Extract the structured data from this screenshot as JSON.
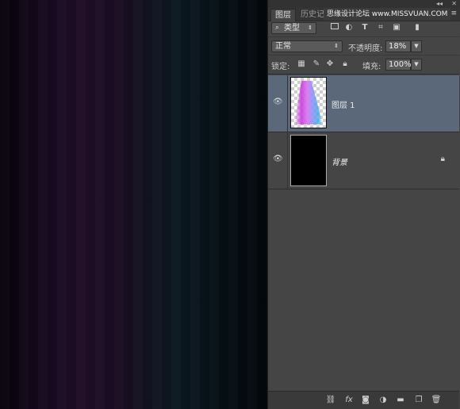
{
  "panel": {
    "tabs": [
      {
        "label": "图层"
      },
      {
        "label": "历史记"
      }
    ],
    "watermark": "思缘设计论坛 www.MISSVUAN.COM",
    "filter": {
      "label": "类型"
    },
    "blend_mode": "正常",
    "opacity_label": "不透明度:",
    "opacity_value": "18%",
    "lock_label": "锁定:",
    "fill_label": "填充:",
    "fill_value": "100%",
    "layers": [
      {
        "name": "图层 1",
        "selected": true
      },
      {
        "name": "背景",
        "locked": true
      }
    ]
  },
  "colors": {
    "panel_bg": "#454545",
    "selected_layer": "#5a687a",
    "canvas_purple": "#1f0d25",
    "canvas_teal": "#0a1820"
  }
}
